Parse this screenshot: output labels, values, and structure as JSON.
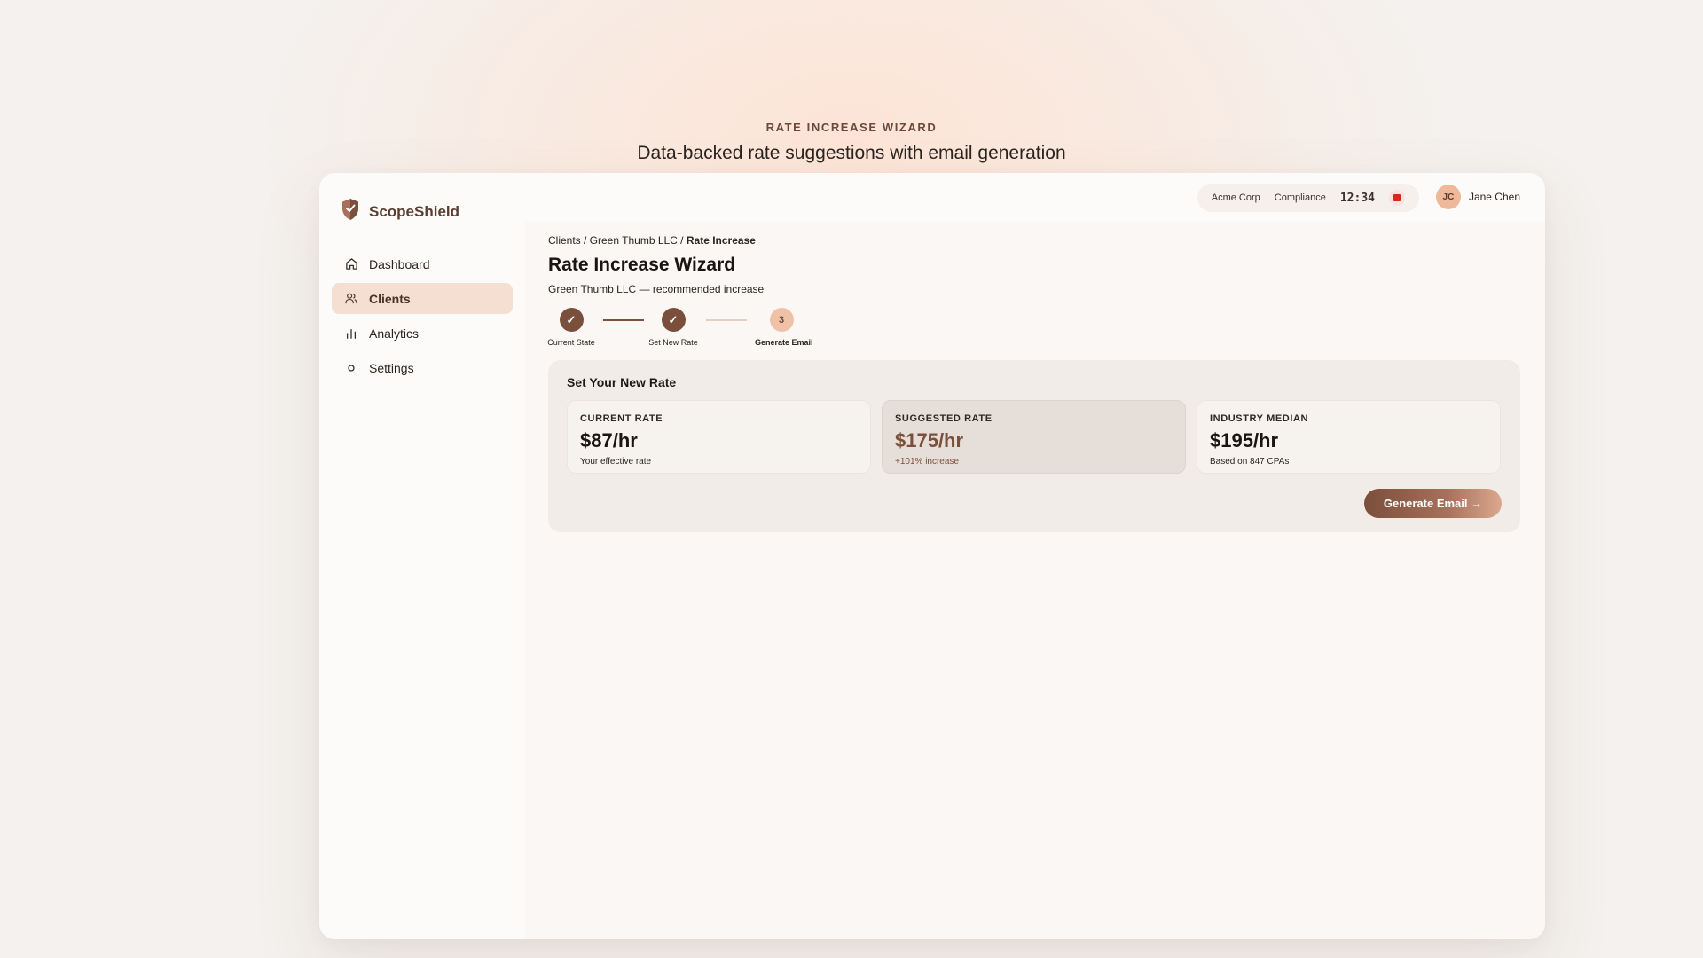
{
  "hero": {
    "eyebrow": "RATE INCREASE WIZARD",
    "title": "Data-backed rate suggestions with email generation"
  },
  "app": {
    "brand": "ScopeShield",
    "brand_icon": "shield-icon"
  },
  "sidebar": {
    "items": [
      {
        "label": "Dashboard",
        "icon": "home-icon",
        "active": false
      },
      {
        "label": "Clients",
        "icon": "users-icon",
        "active": true
      },
      {
        "label": "Analytics",
        "icon": "bar-chart-icon",
        "active": false
      },
      {
        "label": "Settings",
        "icon": "gear-icon",
        "active": false
      }
    ]
  },
  "topbar": {
    "org": "Acme Corp",
    "mode": "Compliance",
    "timer": "12:34",
    "user": {
      "initials": "JC",
      "name": "Jane Chen"
    }
  },
  "breadcrumb": {
    "path": "Clients / Green Thumb LLC / ",
    "current": "Rate Increase"
  },
  "page": {
    "title": "Rate Increase Wizard",
    "subtitle": "Green Thumb LLC — recommended increase"
  },
  "steps": [
    {
      "label": "Current State",
      "status": "done",
      "glyph": "✓"
    },
    {
      "label": "Set New Rate",
      "status": "done",
      "glyph": "✓"
    },
    {
      "label": "Generate Email",
      "status": "current",
      "glyph": "3"
    }
  ],
  "panel": {
    "title": "Set Your New Rate",
    "cards": [
      {
        "label": "CURRENT RATE",
        "value": "$87/hr",
        "note": "Your effective rate"
      },
      {
        "label": "SUGGESTED RATE",
        "value": "$175/hr",
        "note": "+101% increase"
      },
      {
        "label": "INDUSTRY MEDIAN",
        "value": "$195/hr",
        "note": "Based on 847 CPAs"
      }
    ],
    "cta": "Generate Email →"
  },
  "colors": {
    "accent": "#7a4f3b",
    "accent_light": "#efc2a8",
    "active_nav": "#f4dfd2",
    "stop": "#d22a1f"
  }
}
